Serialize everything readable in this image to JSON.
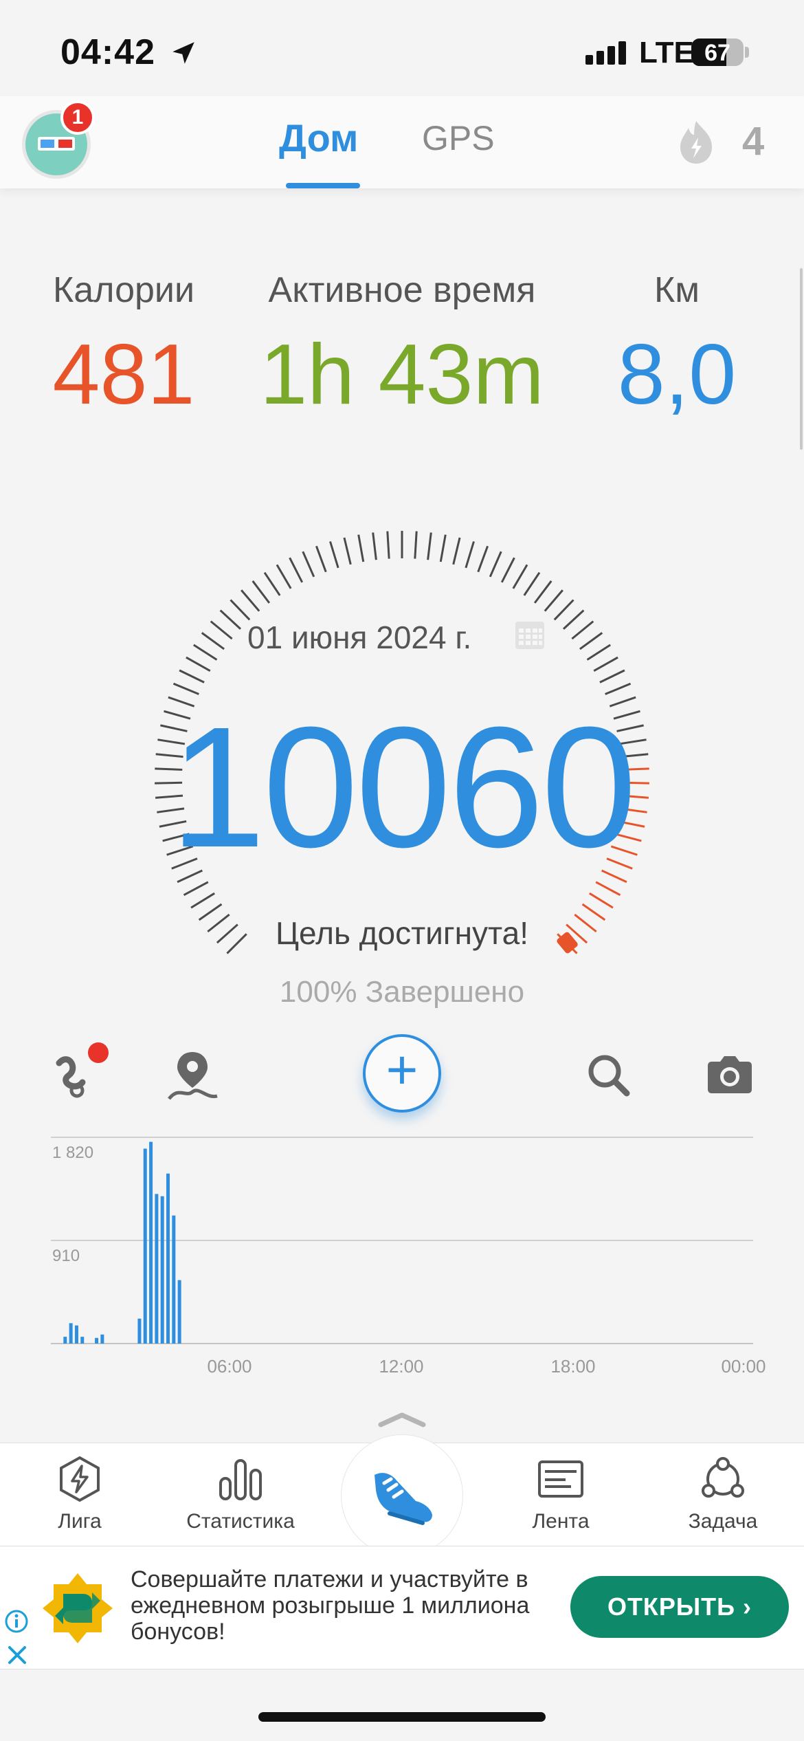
{
  "status_bar": {
    "time": "04:42",
    "network": "LTE",
    "battery_level": "67"
  },
  "header": {
    "notification_count": "1",
    "tabs": [
      {
        "label": "Дом",
        "active": true
      },
      {
        "label": "GPS",
        "active": false
      }
    ],
    "streak_count": "4"
  },
  "stats": [
    {
      "label": "Калории",
      "value": "481",
      "color": "#e8542a"
    },
    {
      "label": "Активное время",
      "value": "1h 43m",
      "color": "#7aa82a"
    },
    {
      "label": "Км",
      "value": "8,0",
      "color": "#2f8fde"
    }
  ],
  "today": {
    "date": "01 июня 2024 г.",
    "steps": "10060",
    "goal_status": "Цель достигнута!",
    "completion": "100% Завершено"
  },
  "actions": {
    "add": "+",
    "icons": [
      "route-icon",
      "map-pin-icon",
      "add-icon",
      "search-icon",
      "camera-icon"
    ]
  },
  "chart_data": {
    "type": "bar",
    "y_ticks": [
      "1 820",
      "910"
    ],
    "ylim": [
      0,
      1820
    ],
    "x_ticks": [
      "06:00",
      "12:00",
      "18:00",
      "00:00"
    ],
    "bars": [
      {
        "hour": 0.2,
        "value": 60
      },
      {
        "hour": 0.4,
        "value": 180
      },
      {
        "hour": 0.6,
        "value": 160
      },
      {
        "hour": 0.8,
        "value": 60
      },
      {
        "hour": 1.3,
        "value": 50
      },
      {
        "hour": 1.5,
        "value": 80
      },
      {
        "hour": 2.8,
        "value": 220
      },
      {
        "hour": 3.0,
        "value": 1720
      },
      {
        "hour": 3.2,
        "value": 1780
      },
      {
        "hour": 3.4,
        "value": 1320
      },
      {
        "hour": 3.6,
        "value": 1300
      },
      {
        "hour": 3.8,
        "value": 1500
      },
      {
        "hour": 4.0,
        "value": 1130
      },
      {
        "hour": 4.2,
        "value": 560
      }
    ],
    "colors": {
      "bar": "#2f8fde",
      "grid": "#d0d0d0"
    }
  },
  "bottom_nav": [
    {
      "label": "Лига",
      "icon": "league-icon"
    },
    {
      "label": "Статистика",
      "icon": "stats-icon"
    },
    {
      "label": "",
      "icon": "shoe-icon"
    },
    {
      "label": "Лента",
      "icon": "feed-icon"
    },
    {
      "label": "Задача",
      "icon": "task-icon"
    }
  ],
  "ad": {
    "text": "Совершайте платежи и участвуйте в ежедневном розыгрыше 1 миллиона бонусов!",
    "button": "ОТКРЫТЬ",
    "accent": "#0e8a6b"
  }
}
